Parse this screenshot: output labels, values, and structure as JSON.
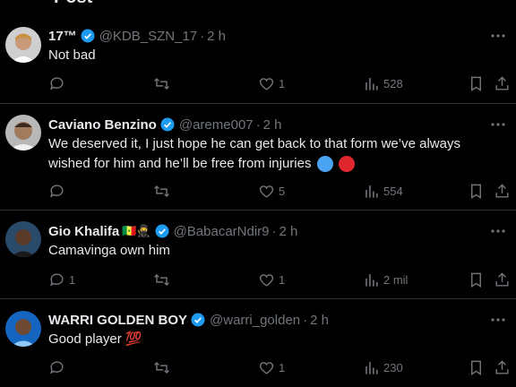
{
  "header": {
    "title": "Post"
  },
  "replies": [
    {
      "name": "17™",
      "handle": "@KDB_SZN_17",
      "time": "2 h",
      "text": "Not bad",
      "likes": "1",
      "views": "528",
      "replies_count": "",
      "retweets": ""
    },
    {
      "name": "Caviano Benzino",
      "handle": "@areme007",
      "time": "2 h",
      "text": "We deserved it, I just hope he can get back to that form we’ve always wished for him and he’ll be free from injuries",
      "likes": "5",
      "views": "554",
      "replies_count": "",
      "retweets": ""
    },
    {
      "name": "Gio Khalifa",
      "flags": "🇸🇳🥷",
      "handle": "@BabacarNdir9",
      "time": "2 h",
      "text": "Camavinga own him",
      "likes": "1",
      "views": "2 mil",
      "replies_count": "1",
      "retweets": ""
    },
    {
      "name": "WARRI GOLDEN BOY",
      "handle": "@warri_golden",
      "time": "2 h",
      "text": "Good player 💯",
      "likes": "1",
      "views": "230",
      "replies_count": "",
      "retweets": ""
    }
  ],
  "colors": {
    "background": "#000000",
    "text": "#e7e9ea",
    "muted": "#71767b",
    "verified": "#1d9bf0",
    "divider": "#2f3336"
  },
  "icons": [
    "reply-icon",
    "retweet-icon",
    "like-icon",
    "views-icon",
    "bookmark-icon",
    "share-icon",
    "more-icon",
    "verified-badge-icon"
  ]
}
